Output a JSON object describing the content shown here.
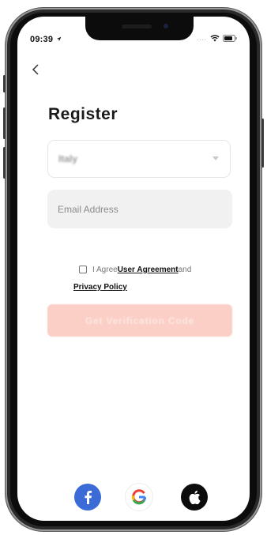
{
  "status_bar": {
    "time": "09:39",
    "signal": "...."
  },
  "header": {
    "back_icon": "chevron-left-icon"
  },
  "page": {
    "title": "Register"
  },
  "form": {
    "country_value": "Italy",
    "email_placeholder": "Email Address",
    "agree_prefix": "I Agree",
    "user_agreement_label": "User Agreement",
    "and_text": "and",
    "privacy_policy_label": "Privacy Policy",
    "submit_label": "Get Verification Code",
    "submit_color": "#fbcfc6"
  },
  "social": {
    "facebook_icon": "facebook-icon",
    "google_icon": "google-icon",
    "apple_icon": "apple-icon",
    "facebook_color": "#3a6bd6"
  }
}
